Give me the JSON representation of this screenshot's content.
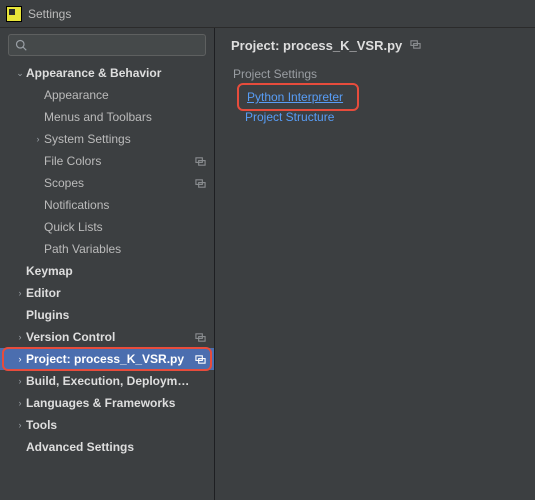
{
  "window": {
    "title": "Settings"
  },
  "search": {
    "placeholder": ""
  },
  "tree": [
    {
      "label": "Appearance & Behavior",
      "level": 0,
      "bold": true,
      "chev": "down",
      "tag": false,
      "selected": false,
      "hl": false
    },
    {
      "label": "Appearance",
      "level": 1,
      "bold": false,
      "chev": "",
      "tag": false,
      "selected": false,
      "hl": false
    },
    {
      "label": "Menus and Toolbars",
      "level": 1,
      "bold": false,
      "chev": "",
      "tag": false,
      "selected": false,
      "hl": false
    },
    {
      "label": "System Settings",
      "level": 1,
      "bold": false,
      "chev": "right",
      "tag": false,
      "selected": false,
      "hl": false
    },
    {
      "label": "File Colors",
      "level": 1,
      "bold": false,
      "chev": "",
      "tag": true,
      "selected": false,
      "hl": false
    },
    {
      "label": "Scopes",
      "level": 1,
      "bold": false,
      "chev": "",
      "tag": true,
      "selected": false,
      "hl": false
    },
    {
      "label": "Notifications",
      "level": 1,
      "bold": false,
      "chev": "",
      "tag": false,
      "selected": false,
      "hl": false
    },
    {
      "label": "Quick Lists",
      "level": 1,
      "bold": false,
      "chev": "",
      "tag": false,
      "selected": false,
      "hl": false
    },
    {
      "label": "Path Variables",
      "level": 1,
      "bold": false,
      "chev": "",
      "tag": false,
      "selected": false,
      "hl": false
    },
    {
      "label": "Keymap",
      "level": 0,
      "bold": true,
      "chev": "",
      "tag": false,
      "selected": false,
      "hl": false
    },
    {
      "label": "Editor",
      "level": 0,
      "bold": true,
      "chev": "right",
      "tag": false,
      "selected": false,
      "hl": false
    },
    {
      "label": "Plugins",
      "level": 0,
      "bold": true,
      "chev": "",
      "tag": false,
      "selected": false,
      "hl": false
    },
    {
      "label": "Version Control",
      "level": 0,
      "bold": true,
      "chev": "right",
      "tag": true,
      "selected": false,
      "hl": false
    },
    {
      "label": "Project: process_K_VSR.py",
      "level": 0,
      "bold": true,
      "chev": "right",
      "tag": true,
      "selected": true,
      "hl": true
    },
    {
      "label": "Build, Execution, Deployment",
      "level": 0,
      "bold": true,
      "chev": "right",
      "tag": false,
      "selected": false,
      "hl": false
    },
    {
      "label": "Languages & Frameworks",
      "level": 0,
      "bold": true,
      "chev": "right",
      "tag": false,
      "selected": false,
      "hl": false
    },
    {
      "label": "Tools",
      "level": 0,
      "bold": true,
      "chev": "right",
      "tag": false,
      "selected": false,
      "hl": false
    },
    {
      "label": "Advanced Settings",
      "level": 0,
      "bold": true,
      "chev": "",
      "tag": false,
      "selected": false,
      "hl": false
    }
  ],
  "main": {
    "title": "Project: process_K_VSR.py",
    "section_heading": "Project Settings",
    "links": [
      {
        "label": "Python Interpreter",
        "hl": true
      },
      {
        "label": "Project Structure",
        "hl": false
      }
    ]
  },
  "glyphs": {
    "chev_right": "›",
    "chev_down": "⌄"
  },
  "colors": {
    "accent_link": "#589df6",
    "selection": "#4b6eaf",
    "highlight": "#e74c3c"
  }
}
